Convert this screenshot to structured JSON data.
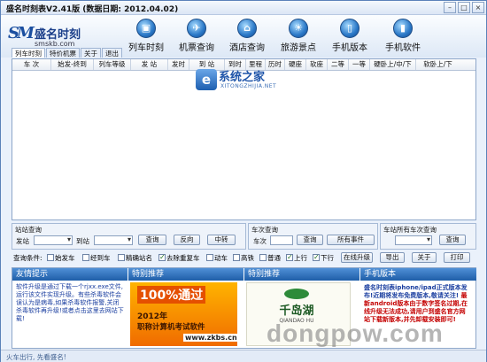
{
  "window": {
    "title": "盛名时刻表V2.41版 (数据日期: 2012.04.02)"
  },
  "brand": {
    "mark": "SM",
    "name": "盛名时刻",
    "url": "smskb.com"
  },
  "toolbar": {
    "buttons": [
      {
        "label": "列车时刻",
        "icon": "train-icon"
      },
      {
        "label": "机票查询",
        "icon": "plane-icon"
      },
      {
        "label": "酒店查询",
        "icon": "hotel-icon"
      },
      {
        "label": "旅游景点",
        "icon": "scenic-icon"
      },
      {
        "label": "手机版本",
        "icon": "phone-icon"
      },
      {
        "label": "手机软件",
        "icon": "phone-app-icon"
      }
    ]
  },
  "tabs": [
    "列车时刻",
    "特价机票",
    "关于",
    "退出"
  ],
  "grid": {
    "columns": [
      "车  次",
      "始发-终到",
      "列车等级",
      "发  站",
      "发时",
      "到  站",
      "到时",
      "里程",
      "历时",
      "硬座",
      "软座",
      "二等",
      "一等",
      "硬卧上/中/下",
      "软卧上/下"
    ]
  },
  "watermark": {
    "name": "系统之家",
    "site": "XITONGZHIJIA.NET",
    "glyph": "e",
    "bottom": "dongpow.com"
  },
  "station_query": {
    "title": "站站查询",
    "from_label": "发站",
    "to_label": "到站",
    "query": "查询",
    "reverse": "反向",
    "transfer": "中转"
  },
  "train_query": {
    "title": "车次查询",
    "train_label": "车次",
    "query": "查询",
    "all": "所有事件"
  },
  "all_trains": {
    "title": "车站所有车次查询",
    "query": "查询"
  },
  "filters": {
    "label": "查询条件:",
    "items": [
      {
        "label": "始发车",
        "checked": false
      },
      {
        "label": "经到车",
        "checked": false
      },
      {
        "label": "精确站名",
        "checked": false
      },
      {
        "label": "去除重复车",
        "checked": true
      },
      {
        "label": "动车",
        "checked": false
      },
      {
        "label": "高铁",
        "checked": false
      },
      {
        "label": "普通",
        "checked": false
      },
      {
        "label": "上行",
        "checked": true
      },
      {
        "label": "下行",
        "checked": true
      }
    ],
    "buttons": [
      "在线升级",
      "导出",
      "关于",
      "打印"
    ]
  },
  "bottom": {
    "tips_title": "友情提示",
    "tips_text": "软件升级是通过下载一个rjxx.exe文件,运行该文件实现升级。有些杀毒软件会误认为是病毒,如果杀毒软件报警,关闭杀毒软件再升级!或者点击这里去网站下载!",
    "promo1_title": "特别推荐",
    "promo1_big": "100%通过",
    "promo1_year": "2012年",
    "promo1_line": "职称计算机考试软件",
    "promo1_url": "www.zkbs.cn",
    "promo2_title": "特别推荐",
    "promo2_name": "千岛湖",
    "promo2_sub": "QIANDAO HU",
    "mobile_title": "手机版本",
    "mobile_text": "盛名时刻表iphone/ipad正式版本发布!近期将发布免费版本,敬请关注!",
    "mobile_red": "最新android版本由于数字签名过期,在线升级无法成功,请用户到盛名官方网站下载新版本,并先卸载安装即可!"
  },
  "status": {
    "text": "火车出行, 先看盛名!"
  }
}
